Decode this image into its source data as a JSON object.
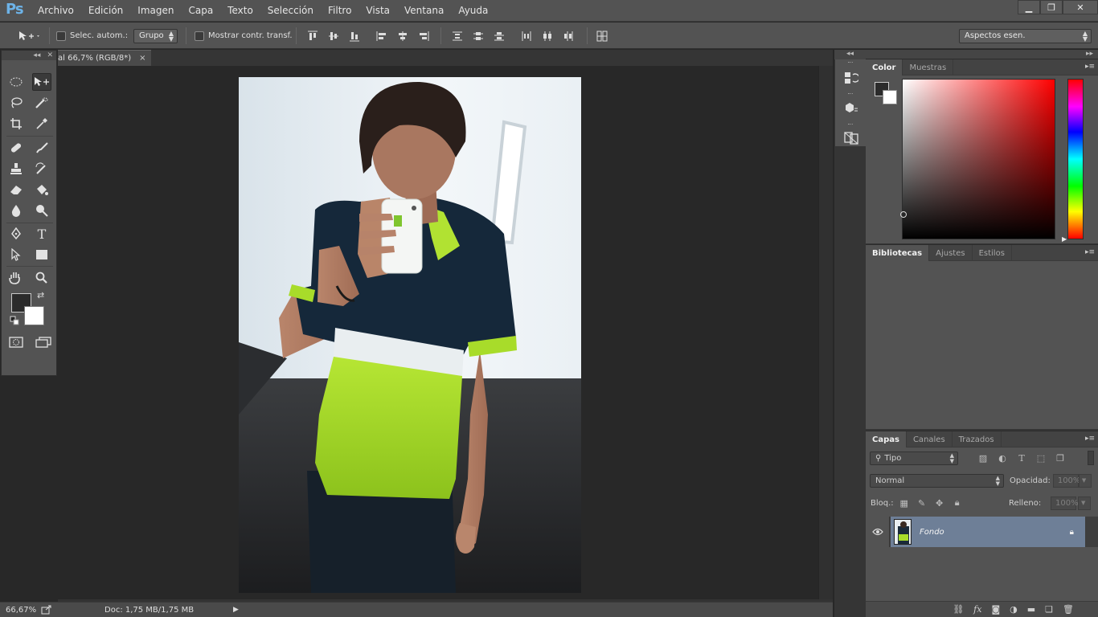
{
  "app": {
    "logo": "Ps",
    "menu": [
      "Archivo",
      "Edición",
      "Imagen",
      "Capa",
      "Texto",
      "Selección",
      "Filtro",
      "Vista",
      "Ventana",
      "Ayuda"
    ],
    "window_controls": {
      "minimize": "▁",
      "restore": "❐",
      "close": "✕"
    }
  },
  "options": {
    "auto_select_label": "Selec. autom.:",
    "auto_select_value": "Grupo",
    "transform_label": "Mostrar contr. transf.",
    "workspace": "Aspectos esen."
  },
  "document": {
    "tab_title": "al 66,7% (RGB/8*)",
    "tab_close": "×"
  },
  "status": {
    "zoom": "66,67%",
    "doc_info": "Doc: 1,75 MB/1,75 MB"
  },
  "color_panel": {
    "tabs": [
      "Color",
      "Muestras"
    ],
    "foreground": "#2b2b2b",
    "background": "#ffffff",
    "hue": "#ff0000"
  },
  "libraries_panel": {
    "tabs": [
      "Bibliotecas",
      "Ajustes",
      "Estilos"
    ]
  },
  "layers_panel": {
    "tabs": [
      "Capas",
      "Canales",
      "Trazados"
    ],
    "filter": "Tipo",
    "blend_mode": "Normal",
    "opacity_label": "Opacidad:",
    "opacity": "100%",
    "lock_label": "Bloq.:",
    "fill_label": "Relleno:",
    "fill": "100%",
    "layers": [
      {
        "name": "Fondo",
        "visible": true,
        "locked": true
      }
    ]
  },
  "icons": {
    "tools": [
      "elliptical-marquee-icon",
      "move-icon",
      "lasso-icon",
      "quick-selection-icon",
      "crop-icon",
      "eyedropper-icon",
      "healing-brush-icon",
      "brush-icon",
      "clone-stamp-icon",
      "history-brush-icon",
      "eraser-icon",
      "paint-bucket-icon",
      "blur-icon",
      "dodge-icon",
      "pen-icon",
      "type-icon",
      "path-selection-icon",
      "rectangle-icon",
      "hand-icon",
      "zoom-icon"
    ]
  },
  "accent_colors": {
    "panel": "#535353",
    "selected_layer": "#6e7f97",
    "shirt_green": "#a5d82a"
  }
}
